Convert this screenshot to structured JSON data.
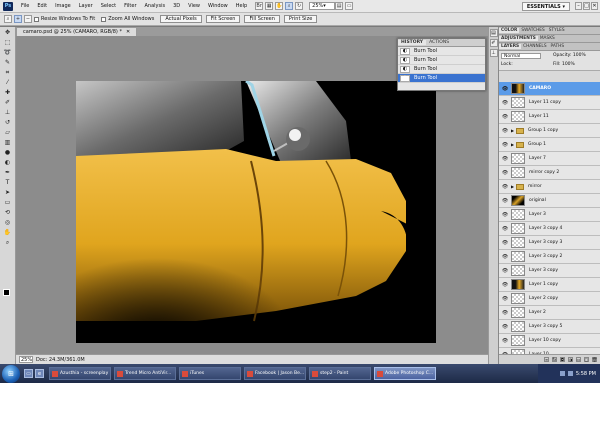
{
  "menubar": {
    "logo": "Ps",
    "items": [
      "File",
      "Edit",
      "Image",
      "Layer",
      "Select",
      "Filter",
      "Analysis",
      "3D",
      "View",
      "Window",
      "Help"
    ],
    "zoom": "25%",
    "workspace": "ESSENTIALS ▾"
  },
  "options": {
    "resize_windows": "Resize Windows To Fit",
    "zoom_all": "Zoom All Windows",
    "actual_pixels": "Actual Pixels",
    "fit_screen": "Fit Screen",
    "fill_screen": "Fill Screen",
    "print_size": "Print Size"
  },
  "document": {
    "tab_title": "camaro.psd @ 25% (CAMARO, RGB/8) *",
    "status_zoom": "25%",
    "status_doc": "Doc: 24.3M/361.0M"
  },
  "history": {
    "tabs": [
      "HISTORY",
      "ACTIONS"
    ],
    "rows": [
      "Burn Tool",
      "Burn Tool",
      "Burn Tool",
      "Burn Tool"
    ]
  },
  "right_panels": {
    "top_tabs": [
      "COLOR",
      "SWATCHES",
      "STYLES"
    ],
    "adj_tabs": [
      "ADJUSTMENTS",
      "MASKS"
    ],
    "layer_tabs": [
      "LAYERS",
      "CHANNELS",
      "PATHS"
    ],
    "blend_mode": "Normal",
    "opacity": "Opacity: 100%",
    "lock": "Lock:",
    "fill": "Fill: 100%"
  },
  "layers": [
    {
      "name": "CAMARO",
      "type": "car",
      "selected": true
    },
    {
      "name": "Layer 11 copy",
      "type": "trans"
    },
    {
      "name": "Layer 11",
      "type": "trans"
    },
    {
      "name": "Group 1 copy",
      "type": "group"
    },
    {
      "name": "Group 1",
      "type": "group"
    },
    {
      "name": "Layer 7",
      "type": "trans"
    },
    {
      "name": "mirror copy 2",
      "type": "trans"
    },
    {
      "name": "mirror",
      "type": "group"
    },
    {
      "name": "original",
      "type": "photo"
    },
    {
      "name": "Layer 3",
      "type": "trans"
    },
    {
      "name": "Layer 3 copy 4",
      "type": "trans"
    },
    {
      "name": "Layer 3 copy 3",
      "type": "trans"
    },
    {
      "name": "Layer 3 copy 2",
      "type": "trans"
    },
    {
      "name": "Layer 3 copy",
      "type": "trans"
    },
    {
      "name": "Layer 1 copy",
      "type": "car"
    },
    {
      "name": "Layer 2 copy",
      "type": "trans"
    },
    {
      "name": "Layer 2",
      "type": "trans"
    },
    {
      "name": "Layer 3 copy 5",
      "type": "trans"
    },
    {
      "name": "Layer 10 copy",
      "type": "trans"
    },
    {
      "name": "Layer 10",
      "type": "trans"
    }
  ],
  "taskbar": {
    "tasks": [
      {
        "label": "Azusthia - screenplay ..."
      },
      {
        "label": "Trend Micro AntiVir..."
      },
      {
        "label": "iTunes"
      },
      {
        "label": "Facebook | Jason Be..."
      },
      {
        "label": "step2 - Paint"
      },
      {
        "label": "Adobe Photoshop C...",
        "active": true
      }
    ],
    "clock": "5:58 PM"
  },
  "colors": {
    "accent": "#3a73d0",
    "car_yellow": "#e1a51d"
  }
}
